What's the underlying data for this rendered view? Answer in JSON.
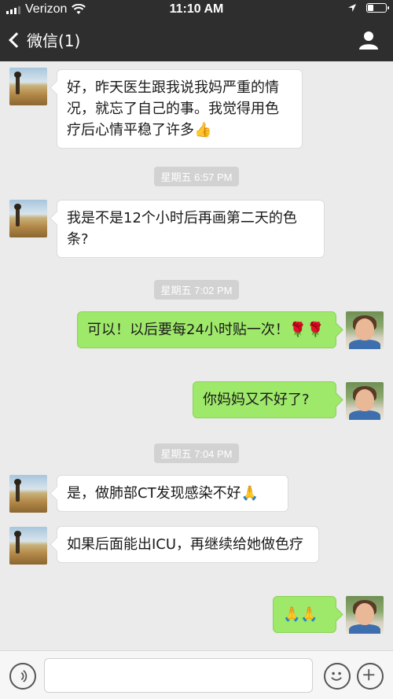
{
  "status_bar": {
    "carrier": "Verizon",
    "time": "11:10 AM"
  },
  "nav": {
    "back_label": "微信(1)"
  },
  "messages": [
    {
      "text": "好，昨天医生跟我说我妈严重的情况，就忘了自己的事。我觉得用色疗后心情平稳了许多👍"
    },
    {
      "text": "我是不是12个小时后再画第二天的色条?"
    },
    {
      "text": "可以！以后要每24小时贴一次！🌹🌹"
    },
    {
      "text": "你妈妈又不好了?"
    },
    {
      "text": "是，做肺部CT发现感染不好🙏"
    },
    {
      "text": "如果后面能出ICU，再继续给她做色疗"
    },
    {
      "text": "🙏🙏"
    }
  ],
  "timestamps": [
    "星期五 6:57 PM",
    "星期五 7:02 PM",
    "星期五 7:04 PM"
  ],
  "input": {
    "value": ""
  },
  "icons": {
    "voice": "voice-icon",
    "emoji": "emoji-icon",
    "plus": "plus-icon",
    "profile": "profile-icon",
    "back": "chevron-left-icon"
  },
  "colors": {
    "bar": "#2e2e2e",
    "chat_bg": "#ebebeb",
    "out_bubble": "#9ee86a",
    "in_bubble": "#ffffff"
  }
}
